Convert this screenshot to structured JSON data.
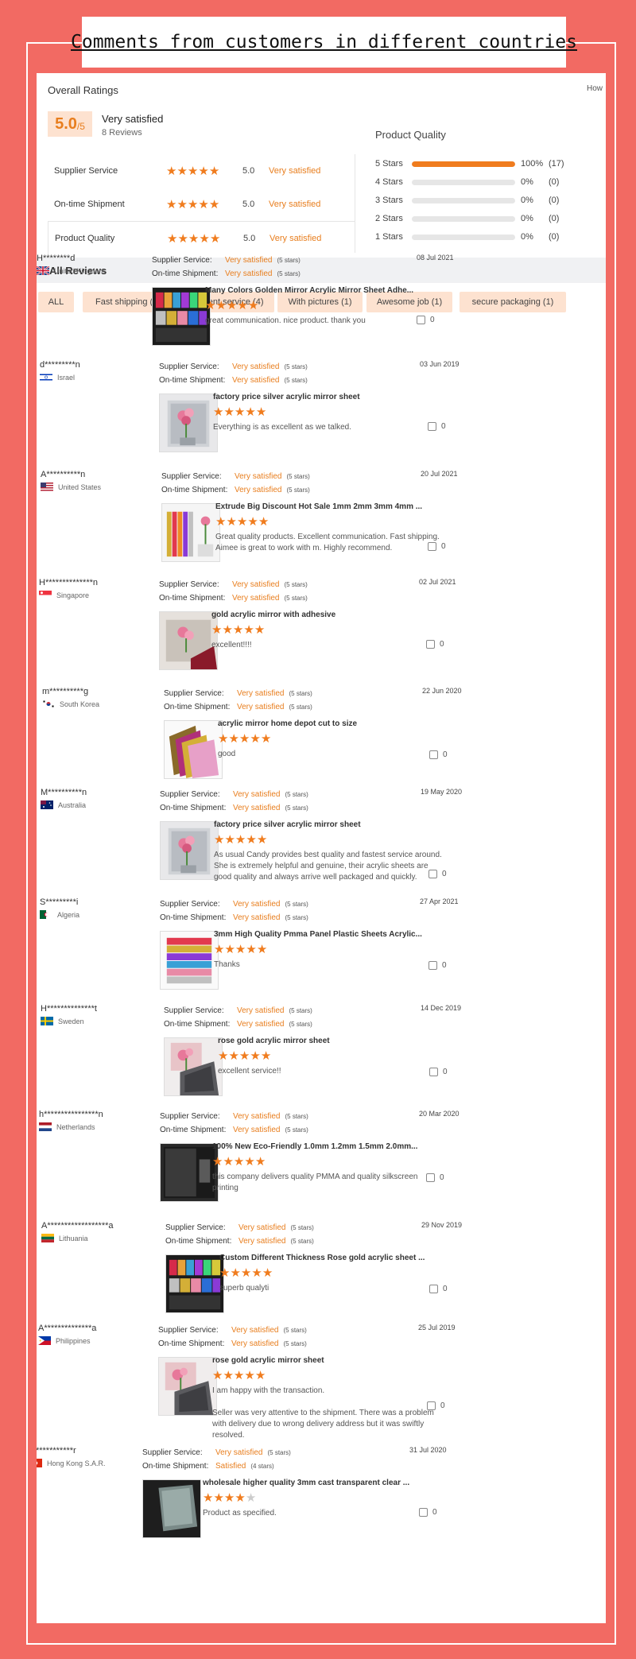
{
  "title": "Comments from customers in different countries",
  "overall": {
    "heading": "Overall Ratings",
    "how_link": "How",
    "score": "5.0",
    "out_of": "/5",
    "label": "Very satisfied",
    "count": "8 Reviews",
    "rows": [
      {
        "name": "Supplier Service",
        "stars": 5,
        "value": "5.0",
        "label": "Very satisfied"
      },
      {
        "name": "On-time Shipment",
        "stars": 5,
        "value": "5.0",
        "label": "Very satisfied"
      },
      {
        "name": "Product Quality",
        "stars": 5,
        "value": "5.0",
        "label": "Very satisfied"
      }
    ]
  },
  "product_quality": {
    "title": "Product Quality",
    "rows": [
      {
        "label": "5 Stars",
        "fraction": 1.0,
        "pct": "100%",
        "count": "(17)"
      },
      {
        "label": "4 Stars",
        "fraction": 0.0,
        "pct": "0%",
        "count": "(0)"
      },
      {
        "label": "3 Stars",
        "fraction": 0.0,
        "pct": "0%",
        "count": "(0)"
      },
      {
        "label": "2 Stars",
        "fraction": 0.0,
        "pct": "0%",
        "count": "(0)"
      },
      {
        "label": "1 Stars",
        "fraction": 0.0,
        "pct": "0%",
        "count": "(0)"
      }
    ]
  },
  "reviews_heading": "All Reviews",
  "filters": [
    "ALL",
    "Fast shipping (8)",
    "Excellent service (4)",
    "With pictures (1)",
    "Awesome job (1)",
    "secure packaging (1)"
  ],
  "labels": {
    "supplier_service": "Supplier Service:",
    "on_time_shipment": "On-time Shipment:"
  },
  "colors": {
    "accent": "#f07c1e",
    "background": "#f26a63",
    "chip": "#fde2d0"
  },
  "reviews": [
    {
      "user": "H********d",
      "country": "United Kingdom",
      "flag": "uk",
      "ss_text": "Very satisfied",
      "ss_stars": "(5 stars)",
      "os_text": "Very satisfied",
      "os_stars": "(5 stars)",
      "date": "08 Jul 2021",
      "product": "Many Colors Golden Mirror Acrylic Mirror Sheet Adhe...",
      "rating": 5,
      "comment": "great communication. nice product. thank you",
      "likes": "0",
      "thumb": "colors-dark"
    },
    {
      "user": "d*********n",
      "country": "Israel",
      "flag": "israel",
      "ss_text": "Very satisfied",
      "ss_stars": "(5 stars)",
      "os_text": "Very satisfied",
      "os_stars": "(5 stars)",
      "date": "03 Jun 2019",
      "product": "factory price silver acrylic mirror sheet",
      "rating": 5,
      "comment": "Everything is as excellent as we talked.",
      "likes": "0",
      "thumb": "mirror-flowers"
    },
    {
      "user": "A**********n",
      "country": "United States",
      "flag": "us",
      "ss_text": "Very satisfied",
      "ss_stars": "(5 stars)",
      "os_text": "Very satisfied",
      "os_stars": "(5 stars)",
      "date": "20 Jul 2021",
      "product": "Extrude Big Discount Hot Sale 1mm 2mm 3mm 4mm ...",
      "rating": 5,
      "comment": "Great quality products. Excellent communication. Fast shipping. Aimee is great to work with m. Highly recommend.",
      "likes": "0",
      "thumb": "colors-white"
    },
    {
      "user": "H**************n",
      "country": "Singapore",
      "flag": "singapore",
      "ss_text": "Very satisfied",
      "ss_stars": "(5 stars)",
      "os_text": "Very satisfied",
      "os_stars": "(5 stars)",
      "date": "02 Jul 2021",
      "product": "gold acrylic mirror with adhesive",
      "rating": 5,
      "comment": "excellent!!!!",
      "likes": "0",
      "thumb": "mirror-red"
    },
    {
      "user": "m**********g",
      "country": "South Korea",
      "flag": "korea",
      "ss_text": "Very satisfied",
      "ss_stars": "(5 stars)",
      "os_text": "Very satisfied",
      "os_stars": "(5 stars)",
      "date": "22 Jun 2020",
      "product": "acrylic mirror home depot cut to size",
      "rating": 5,
      "comment": "good",
      "likes": "0",
      "thumb": "colors-fan"
    },
    {
      "user": "M**********n",
      "country": "Australia",
      "flag": "australia",
      "ss_text": "Very satisfied",
      "ss_stars": "(5 stars)",
      "os_text": "Very satisfied",
      "os_stars": "(5 stars)",
      "date": "19 May 2020",
      "product": "factory price silver acrylic mirror sheet",
      "rating": 5,
      "comment": "As usual Candy provides best quality and fastest service around. She is extremely helpful and genuine, their acrylic sheets are good quality and always arrive well packaged and quickly.",
      "likes": "0",
      "thumb": "mirror-flowers"
    },
    {
      "user": "S*********i",
      "country": "Algeria",
      "flag": "algeria",
      "ss_text": "Very satisfied",
      "ss_stars": "(5 stars)",
      "os_text": "Very satisfied",
      "os_stars": "(5 stars)",
      "date": "27 Apr 2021",
      "product": "3mm High Quality Pmma Panel Plastic Sheets Acrylic...",
      "rating": 5,
      "comment": "Thanks",
      "likes": "0",
      "thumb": "colors-stripes"
    },
    {
      "user": "H**************t",
      "country": "Sweden",
      "flag": "sweden",
      "ss_text": "Very satisfied",
      "ss_stars": "(5 stars)",
      "os_text": "Very satisfied",
      "os_stars": "(5 stars)",
      "date": "14 Dec 2019",
      "product": "rose gold acrylic mirror sheet",
      "rating": 5,
      "comment": "excellent service!!",
      "likes": "0",
      "thumb": "mirror-pink"
    },
    {
      "user": "h****************n",
      "country": "Netherlands",
      "flag": "netherlands",
      "ss_text": "Very satisfied",
      "ss_stars": "(5 stars)",
      "os_text": "Very satisfied",
      "os_stars": "(5 stars)",
      "date": "20 Mar 2020",
      "product": "100% New Eco-Friendly 1.0mm 1.2mm 1.5mm 2.0mm...",
      "rating": 5,
      "comment": "this company delivers quality PMMA and quality silkscreen printing",
      "likes": "0",
      "thumb": "dark-panel"
    },
    {
      "user": "A******************a",
      "country": "Lithuania",
      "flag": "lithuania",
      "ss_text": "Very satisfied",
      "ss_stars": "(5 stars)",
      "os_text": "Very satisfied",
      "os_stars": "(5 stars)",
      "date": "29 Nov 2019",
      "product": "Custom Different Thickness Rose gold acrylic sheet ...",
      "rating": 5,
      "comment": "superb qualyti",
      "likes": "0",
      "thumb": "colors-dark"
    },
    {
      "user": "A**************a",
      "country": "Philippines",
      "flag": "philippines",
      "ss_text": "Very satisfied",
      "ss_stars": "(5 stars)",
      "os_text": "Very satisfied",
      "os_stars": "(5 stars)",
      "date": "25 Jul 2019",
      "product": "rose gold acrylic mirror sheet",
      "rating": 5,
      "comment": "I am happy with the transaction.\n\nSeller was very attentive to the shipment. There was a problem with delivery due to wrong delivery address but it was swiftly resolved.",
      "likes": "0",
      "thumb": "mirror-pink"
    },
    {
      "user": "N***********r",
      "country": "Hong Kong S.A.R.",
      "flag": "hongkong",
      "ss_text": "Very satisfied",
      "ss_stars": "(5 stars)",
      "os_text": "Satisfied",
      "os_stars": "(4 stars)",
      "date": "31 Jul 2020",
      "product": "wholesale higher quality 3mm cast transparent clear ...",
      "rating": 4,
      "comment": "Product as specified.",
      "likes": "0",
      "thumb": "clear-dark"
    }
  ]
}
